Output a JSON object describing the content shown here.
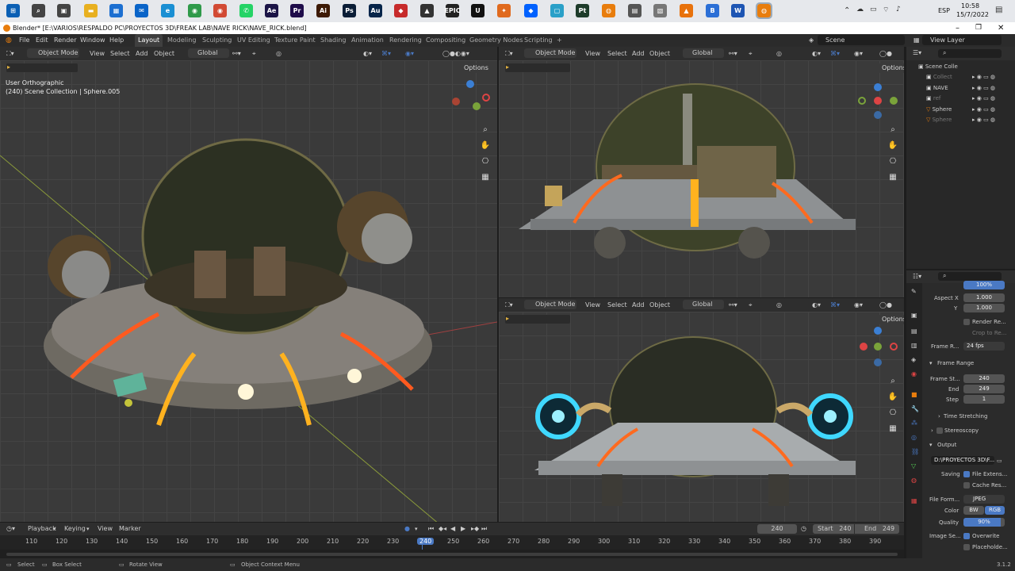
{
  "taskbar": {
    "clock_time": "10:58",
    "clock_date": "15/7/2022",
    "lang": "ESP",
    "apps": [
      {
        "name": "start-icon",
        "label": "⊞",
        "color": "#0a5fb4"
      },
      {
        "name": "search-icon",
        "label": "⌕",
        "color": "#444"
      },
      {
        "name": "task-view-icon",
        "label": "▣",
        "color": "#444"
      },
      {
        "name": "file-explorer-icon",
        "label": "▬",
        "color": "#e8b020"
      },
      {
        "name": "store-icon",
        "label": "▦",
        "color": "#1c6fd1"
      },
      {
        "name": "mail-icon",
        "label": "✉",
        "color": "#0a64c8"
      },
      {
        "name": "edge-icon",
        "label": "e",
        "color": "#1a8fd3"
      },
      {
        "name": "chrome-icon",
        "label": "◉",
        "color": "#2f9a4a"
      },
      {
        "name": "chrome-2-icon",
        "label": "◉",
        "color": "#d24a34"
      },
      {
        "name": "whatsapp-icon",
        "label": "✆",
        "color": "#25d366"
      },
      {
        "name": "after-effects-icon",
        "label": "Ae",
        "color": "#1b1446"
      },
      {
        "name": "premiere-icon",
        "label": "Pr",
        "color": "#1e0c4a"
      },
      {
        "name": "illustrator-icon",
        "label": "Ai",
        "color": "#3d1a05"
      },
      {
        "name": "photoshop-icon",
        "label": "Ps",
        "color": "#0a1d36"
      },
      {
        "name": "audition-icon",
        "label": "Au",
        "color": "#07254a"
      },
      {
        "name": "app-red-icon",
        "label": "◆",
        "color": "#c72b2b"
      },
      {
        "name": "inkscape-icon",
        "label": "▲",
        "color": "#333"
      },
      {
        "name": "epic-games-icon",
        "label": "EPIC",
        "color": "#222"
      },
      {
        "name": "unreal-icon",
        "label": "U",
        "color": "#111"
      },
      {
        "name": "blender-alt-icon",
        "label": "✦",
        "color": "#e06a1e"
      },
      {
        "name": "dropbox-icon",
        "label": "◆",
        "color": "#0061fe"
      },
      {
        "name": "box-app-icon",
        "label": "▢",
        "color": "#2aa0c8"
      },
      {
        "name": "pt-icon",
        "label": "Pt",
        "color": "#1d3b2a"
      },
      {
        "name": "blender-icon",
        "label": "◍",
        "color": "#e87d0d"
      },
      {
        "name": "app-gray-icon",
        "label": "▤",
        "color": "#555"
      },
      {
        "name": "app-gray2-icon",
        "label": "▧",
        "color": "#777"
      },
      {
        "name": "vlc-icon",
        "label": "▲",
        "color": "#e8720c"
      },
      {
        "name": "app-blue-icon",
        "label": "B",
        "color": "#2b6fd6"
      },
      {
        "name": "word-icon",
        "label": "W",
        "color": "#1d55b3"
      },
      {
        "name": "blender-active-icon",
        "label": "◍",
        "color": "#e87d0d"
      }
    ]
  },
  "window": {
    "title": "Blender* [E:\\VARIOS\\RESPALDO PC\\PROYECTOS 3D\\FREAK LAB\\NAVE RICK\\NAVE_RICK.blend]"
  },
  "menubar": {
    "file": "File",
    "edit": "Edit",
    "render": "Render",
    "window": "Window",
    "help": "Help",
    "workspaces": [
      "Layout",
      "Modeling",
      "Sculpting",
      "UV Editing",
      "Texture Paint",
      "Shading",
      "Animation",
      "Rendering",
      "Compositing",
      "Geometry Nodes",
      "Scripting"
    ],
    "add_tab": "+",
    "scene": "Scene",
    "view_layer": "View Layer"
  },
  "viewport_main": {
    "mode": "Object Mode",
    "menus": [
      "View",
      "Select",
      "Add",
      "Object"
    ],
    "orientation": "Global",
    "options": "Options",
    "overlay_line1": "User Orthographic",
    "overlay_line2": "(240) Scene Collection | Sphere.005"
  },
  "viewport_top_right": {
    "mode": "Object Mode",
    "menus": [
      "View",
      "Select",
      "Add",
      "Object"
    ],
    "orientation": "Global",
    "options": "Options"
  },
  "viewport_bottom_right": {
    "mode": "Object Mode",
    "menus": [
      "View",
      "Select",
      "Add",
      "Object"
    ],
    "orientation": "Global",
    "options": "Options"
  },
  "outliner": {
    "root": "Scene Colle",
    "items": [
      {
        "label": "Collect",
        "dim": true
      },
      {
        "label": "NAVE",
        "dim": false
      },
      {
        "label": "ref",
        "dim": true
      },
      {
        "label": "Sphere",
        "dim": false
      },
      {
        "label": "Sphere",
        "dim": true
      }
    ]
  },
  "properties": {
    "percent": "100%",
    "aspect_x_label": "Aspect X",
    "aspect_x": "1.000",
    "aspect_y_label": "Y",
    "aspect_y": "1.000",
    "render_region": "Render Re...",
    "crop_region": "Crop to Re...",
    "frame_rate_label": "Frame R...",
    "frame_rate": "24 fps",
    "frame_range_section": "Frame Range",
    "frame_start_label": "Frame St...",
    "frame_start": "240",
    "end_label": "End",
    "end": "249",
    "step_label": "Step",
    "step": "1",
    "time_stretching": "Time Stretching",
    "stereoscopy": "Stereoscopy",
    "output_section": "Output",
    "output_path": "D:\\PROYECTOS 3D\\F...",
    "saving_label": "Saving",
    "file_extensions": "File Extens...",
    "cache_result": "Cache Res...",
    "file_format_label": "File Form...",
    "file_format": "JPEG",
    "color_label": "Color",
    "color_bw": "BW",
    "color_rgb": "RGB",
    "quality_label": "Quality",
    "quality": "90%",
    "image_seq_label": "Image Se...",
    "overwrite": "Overwrite",
    "placeholders": "Placeholde..."
  },
  "timeline": {
    "menus": [
      "Playback",
      "Keying",
      "View",
      "Marker"
    ],
    "current_frame": "240",
    "start_label": "Start",
    "start": "240",
    "end_label": "End",
    "end": "249",
    "ruler": [
      "110",
      "120",
      "130",
      "140",
      "150",
      "160",
      "170",
      "180",
      "190",
      "200",
      "210",
      "220",
      "230",
      "240",
      "250",
      "260",
      "270",
      "280",
      "290",
      "300",
      "310",
      "320",
      "330",
      "340",
      "350",
      "360",
      "370",
      "380",
      "390"
    ]
  },
  "statusbar": {
    "select": "Select",
    "box_select": "Box Select",
    "rotate_view": "Rotate View",
    "context_menu": "Object Context Menu",
    "version": "3.1.2"
  },
  "colors": {
    "accent": "#4a79c4",
    "selection_orange": "#e87d0d",
    "frame_marker": "#4a79c4",
    "glow_cyan": "#3fd8ff"
  }
}
